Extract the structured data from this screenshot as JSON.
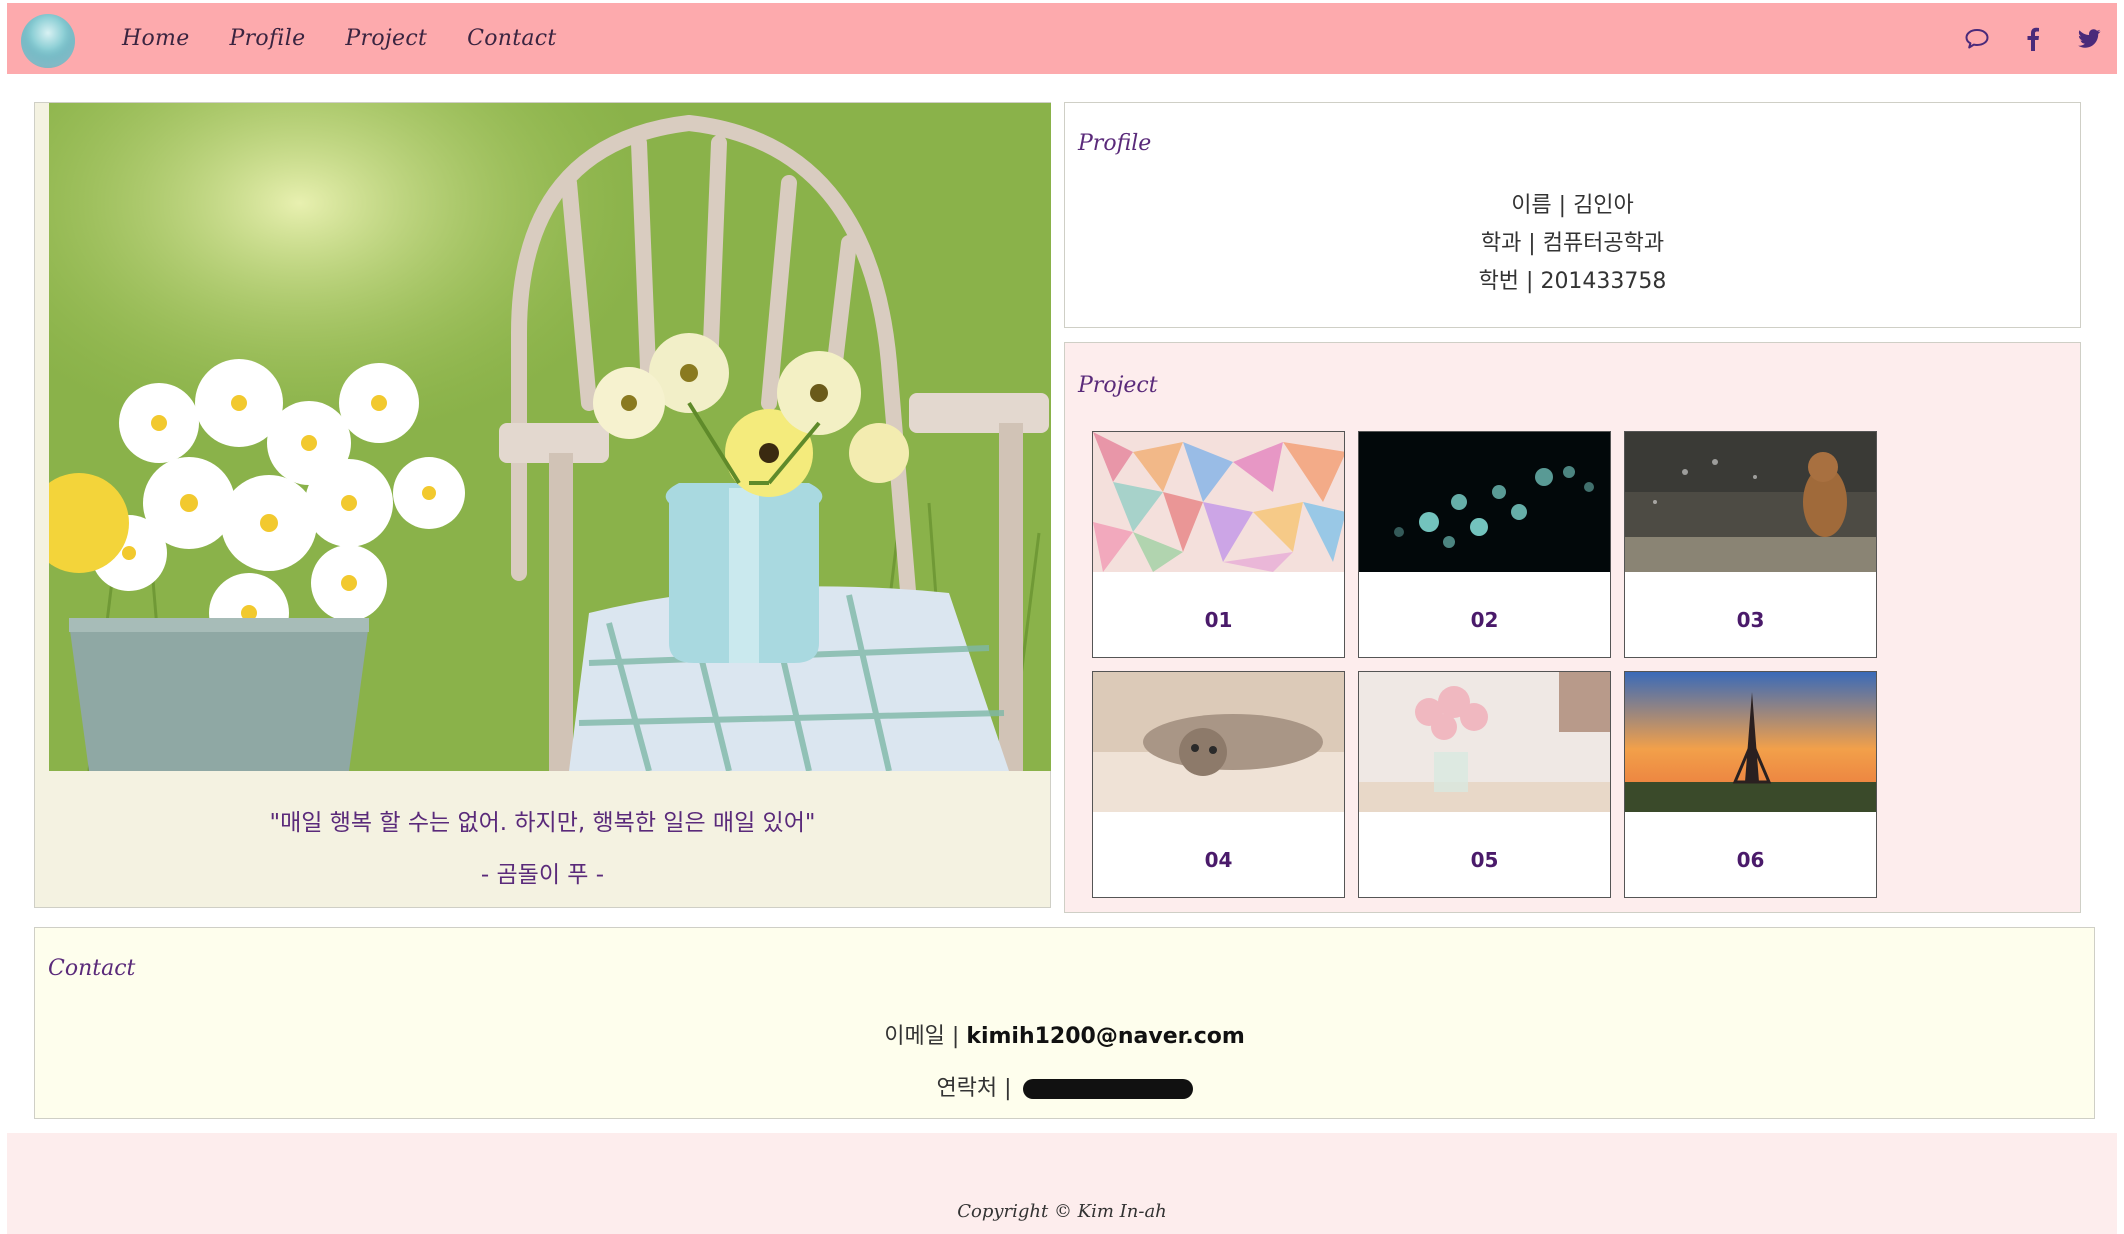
{
  "nav": {
    "links": [
      "Home",
      "Profile",
      "Project",
      "Contact"
    ],
    "icons": [
      "chat-bubble-icon",
      "facebook-icon",
      "twitter-icon"
    ],
    "background": "#fdaaad"
  },
  "hero": {
    "quote": "\"매일 행복 할 수는 없어. 하지만, 행복한 일은 매일 있어\"",
    "author": "- 곰돌이 푸 -"
  },
  "profile": {
    "title": "Profile",
    "lines": [
      "이름 | 김인아",
      "학과 | 컴퓨터공학과",
      "학번 | 201433758"
    ]
  },
  "project": {
    "title": "Project",
    "items": [
      "01",
      "02",
      "03",
      "04",
      "05",
      "06"
    ]
  },
  "contact": {
    "title": "Contact",
    "email_label": "이메일 | ",
    "email": "kimih1200@naver.com",
    "phone_label": "연락처 | "
  },
  "footer": {
    "copyright": "Copyright © Kim In-ah"
  }
}
